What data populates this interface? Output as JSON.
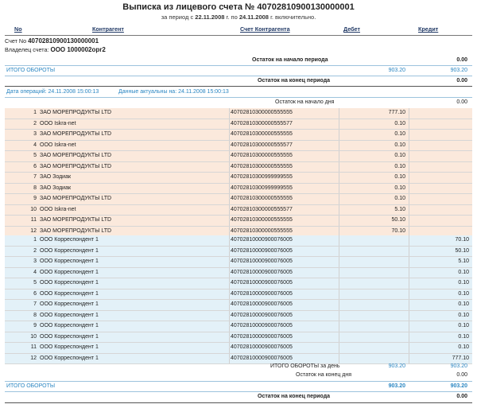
{
  "header": {
    "title": "Выписка из лицевого счета № 40702810900130000001",
    "subtitle_prefix": "за период с",
    "date_from": "22.11.2008",
    "subtitle_mid": "г. по",
    "date_to": "24.11.2008",
    "subtitle_suffix": "г. включительно."
  },
  "columns": {
    "no": "No",
    "counterparty": "Контрагент",
    "counterparty_account": "Счет Контрагента",
    "debit": "Дебет",
    "credit": "Кредит"
  },
  "account": {
    "number_label": "Счет No",
    "number": "40702810900130000001",
    "owner_label": "Владелец счета:",
    "owner": "ООО 1000002opr2"
  },
  "summary_top": {
    "opening_label": "Остаток на начало периода",
    "opening_value": "0.00",
    "totals_label": "ИТОГО ОБОРОТЫ",
    "totals_debit": "903.20",
    "totals_credit": "903.20",
    "closing_label": "Остаток на конец периода",
    "closing_value": "0.00"
  },
  "operations": {
    "date_label": "Дата операций: 24.11.2008 15:00:13",
    "actual_label": "Данные актуальны на: 24.11.2008 15:00:13",
    "day_opening_label": "Остаток на начало дня",
    "day_opening_value": "0.00"
  },
  "debit_rows": [
    {
      "no": "1",
      "name": "ЗАО МОРЕПРОДУКТЫ LTD",
      "account": "40702810300000555555",
      "debit": "777.10"
    },
    {
      "no": "2",
      "name": "ООО Iskra-net",
      "account": "40702810300000555577",
      "debit": "0.10"
    },
    {
      "no": "3",
      "name": "ЗАО МОРЕПРОДУКТЫ LTD",
      "account": "40702810300000555555",
      "debit": "0.10"
    },
    {
      "no": "4",
      "name": "ООО Iskra-net",
      "account": "40702810300000555577",
      "debit": "0.10"
    },
    {
      "no": "5",
      "name": "ЗАО МОРЕПРОДУКТЫ LTD",
      "account": "40702810300000555555",
      "debit": "0.10"
    },
    {
      "no": "6",
      "name": "ЗАО МОРЕПРОДУКТЫ LTD",
      "account": "40702810300000555555",
      "debit": "0.10"
    },
    {
      "no": "7",
      "name": "ЗАО Зодиак",
      "account": "40702810300999999555",
      "debit": "0.10"
    },
    {
      "no": "8",
      "name": "ЗАО Зодиак",
      "account": "40702810300999999555",
      "debit": "0.10"
    },
    {
      "no": "9",
      "name": "ЗАО МОРЕПРОДУКТЫ LTD",
      "account": "40702810300000555555",
      "debit": "0.10"
    },
    {
      "no": "10",
      "name": "ООО Iskra-net",
      "account": "40702810300000555577",
      "debit": "5.10"
    },
    {
      "no": "11",
      "name": "ЗАО МОРЕПРОДУКТЫ LTD",
      "account": "40702810300000555555",
      "debit": "50.10"
    },
    {
      "no": "12",
      "name": "ЗАО МОРЕПРОДУКТЫ LTD",
      "account": "40702810300000555555",
      "debit": "70.10"
    }
  ],
  "credit_rows": [
    {
      "no": "1",
      "name": "ООО Корреспондент 1",
      "account": "40702810000900076005",
      "credit": "70.10"
    },
    {
      "no": "2",
      "name": "ООО Корреспондент 1",
      "account": "40702810000900076005",
      "credit": "50.10"
    },
    {
      "no": "3",
      "name": "ООО Корреспондент 1",
      "account": "40702810000900076005",
      "credit": "5.10"
    },
    {
      "no": "4",
      "name": "ООО Корреспондент 1",
      "account": "40702810000900076005",
      "credit": "0.10"
    },
    {
      "no": "5",
      "name": "ООО Корреспондент 1",
      "account": "40702810000900076005",
      "credit": "0.10"
    },
    {
      "no": "6",
      "name": "ООО Корреспондент 1",
      "account": "40702810000900076005",
      "credit": "0.10"
    },
    {
      "no": "7",
      "name": "ООО Корреспондент 1",
      "account": "40702810000900076005",
      "credit": "0.10"
    },
    {
      "no": "8",
      "name": "ООО Корреспондент 1",
      "account": "40702810000900076005",
      "credit": "0.10"
    },
    {
      "no": "9",
      "name": "ООО Корреспондент 1",
      "account": "40702810000900076005",
      "credit": "0.10"
    },
    {
      "no": "10",
      "name": "ООО Корреспондент 1",
      "account": "40702810000900076005",
      "credit": "0.10"
    },
    {
      "no": "11",
      "name": "ООО Корреспондент 1",
      "account": "40702810000900076005",
      "credit": "0.10"
    },
    {
      "no": "12",
      "name": "ООО Корреспондент 1",
      "account": "40702810000900076005",
      "credit": "777.10"
    }
  ],
  "day_summary": {
    "totals_label": "ИТОГО ОБОРОТЫ за день",
    "totals_debit": "903.20",
    "totals_credit": "903.20",
    "closing_label": "Остаток на конец дня",
    "closing_value": "0.00"
  },
  "summary_bottom": {
    "totals_label": "ИТОГО ОБОРОТЫ",
    "totals_debit": "903.20",
    "totals_credit": "903.20",
    "closing_label": "Остаток на конец периода",
    "closing_value": "0.00"
  }
}
